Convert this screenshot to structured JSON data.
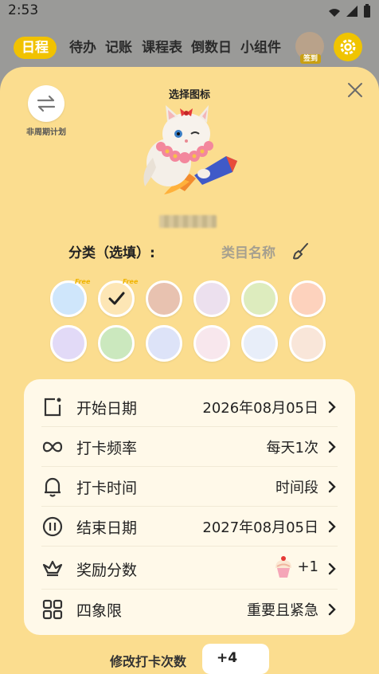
{
  "status": {
    "time": "2:53"
  },
  "nav": {
    "tabs": [
      "日程",
      "待办",
      "记账",
      "课程表",
      "倒数日",
      "小组件"
    ],
    "sign_in": "签到"
  },
  "sheet": {
    "swap_label": "非周期计划",
    "choose_icon": "选择图标",
    "category_label": "分类（选填）:",
    "category_placeholder": "类目名称",
    "free_tag": "Free"
  },
  "swatches": [
    "#cfe6fb",
    "#fde6b5",
    "#e8c2b0",
    "#ece0ee",
    "#ddecbe",
    "#fdd2bd",
    "#e2daf7",
    "#cbe8be",
    "#dde3f8",
    "#f8e7ed",
    "#e8eef9",
    "#f9e6d9"
  ],
  "settings": [
    {
      "icon": "calendar-icon",
      "label": "开始日期",
      "value": "2026年08月05日"
    },
    {
      "icon": "infinity-icon",
      "label": "打卡频率",
      "value": "每天1次"
    },
    {
      "icon": "bell-icon",
      "label": "打卡时间",
      "value": "时间段"
    },
    {
      "icon": "pause-circle-icon",
      "label": "结束日期",
      "value": "2027年08月05日"
    },
    {
      "icon": "crown-icon",
      "label": "奖励分数",
      "value": "+1"
    },
    {
      "icon": "quadrant-icon",
      "label": "四象限",
      "value": "重要且紧急"
    }
  ],
  "footer": {
    "label": "修改打卡次数",
    "value": "+4"
  },
  "colors": {
    "accent": "#f0c400",
    "sheet": "#fbdd8f",
    "card": "#fff9e9"
  }
}
